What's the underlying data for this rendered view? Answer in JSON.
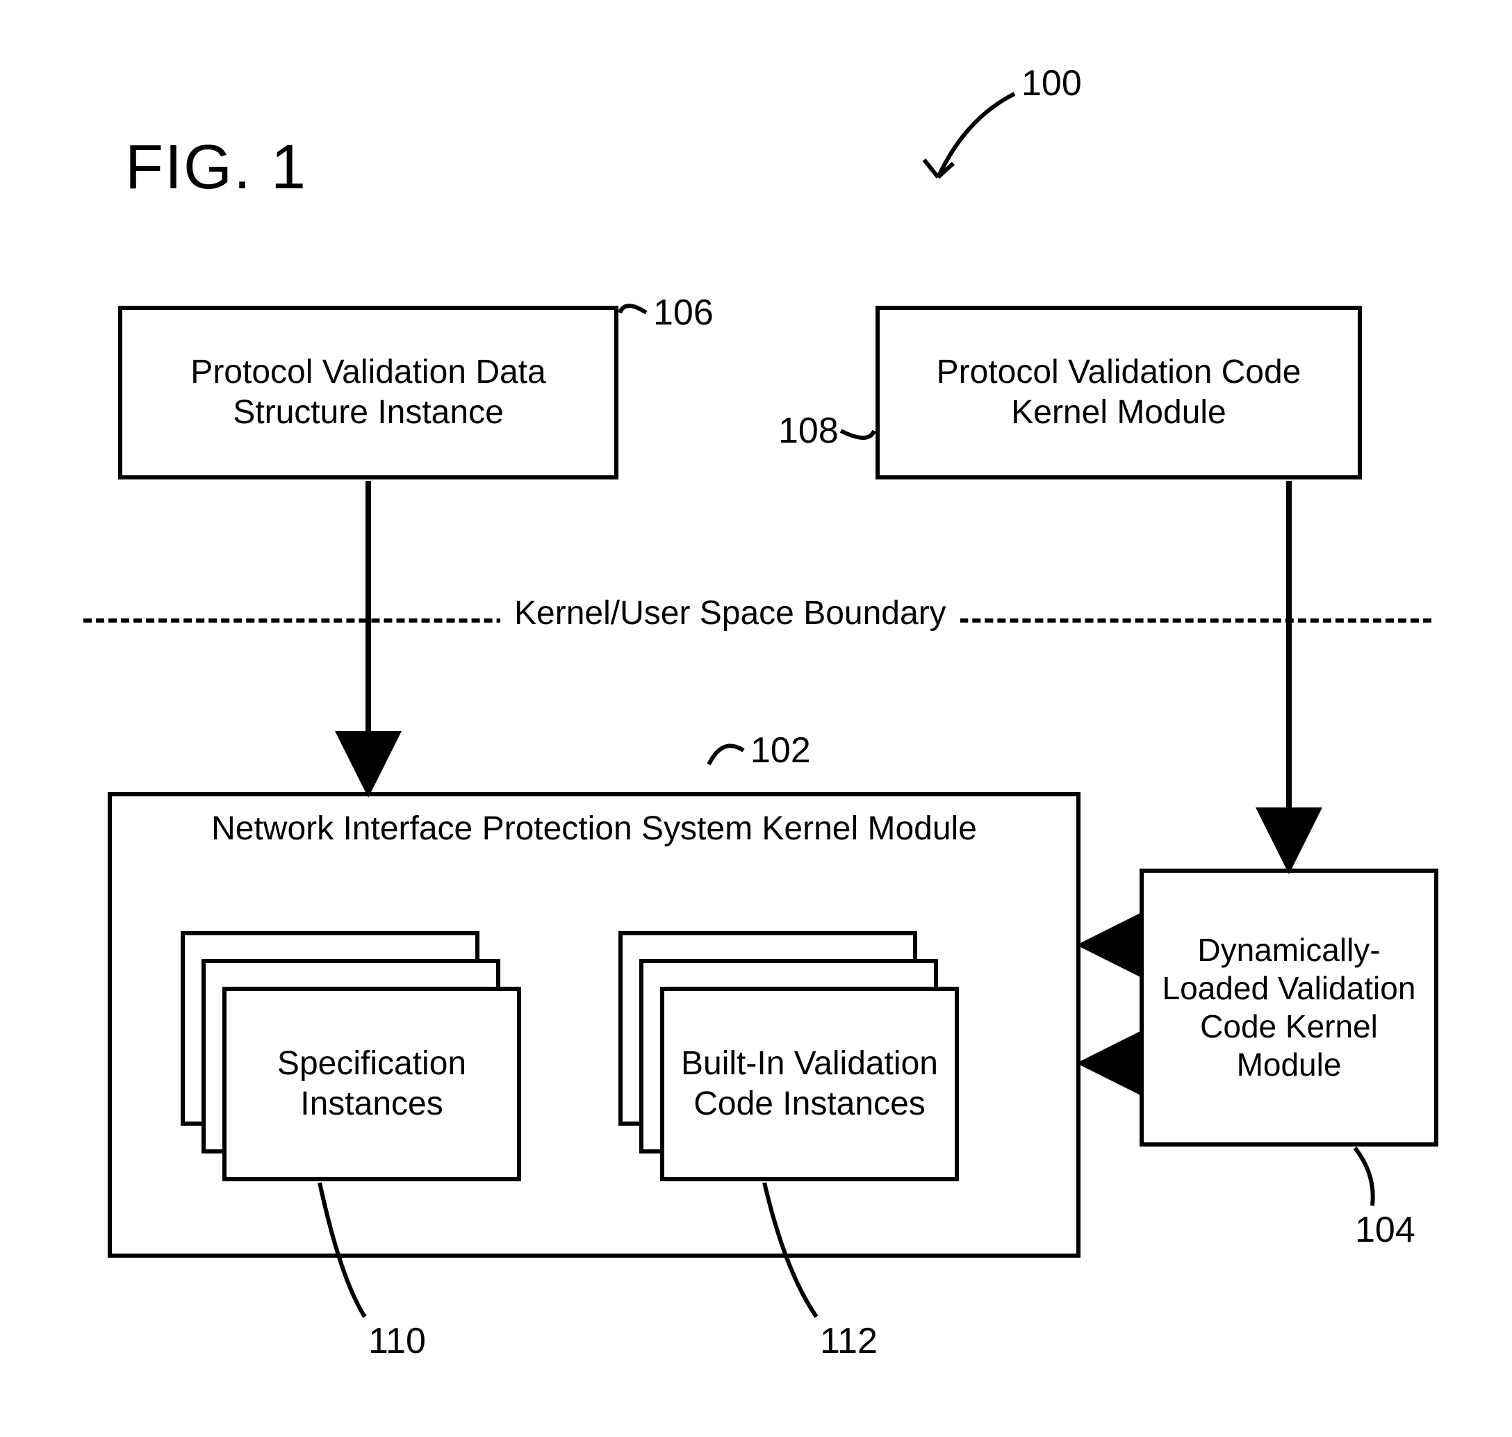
{
  "figure": {
    "title": "FIG. 1",
    "overall_ref": "100",
    "boundary_label": "Kernel/User Space Boundary"
  },
  "boxes": {
    "pvds": {
      "label": "Protocol Validation Data Structure Instance",
      "ref": "106"
    },
    "pvckm": {
      "label": "Protocol Validation Code Kernel Module",
      "ref": "108"
    },
    "nips": {
      "label": "Network Interface Protection System Kernel Module",
      "ref": "102"
    },
    "spec": {
      "label": "Specification Instances",
      "ref": "110"
    },
    "builtin": {
      "label": "Built-In Validation Code Instances",
      "ref": "112"
    },
    "dlvc": {
      "label": "Dynamically-Loaded Validation Code Kernel Module",
      "ref": "104"
    }
  },
  "chart_data": {
    "type": "diagram",
    "nodes": [
      {
        "id": "106",
        "label": "Protocol Validation Data Structure Instance",
        "region": "user-space"
      },
      {
        "id": "108",
        "label": "Protocol Validation Code Kernel Module",
        "region": "user-space"
      },
      {
        "id": "102",
        "label": "Network Interface Protection System Kernel Module",
        "region": "kernel-space"
      },
      {
        "id": "110",
        "label": "Specification Instances",
        "parent": "102",
        "region": "kernel-space",
        "stacked": true
      },
      {
        "id": "112",
        "label": "Built-In Validation Code Instances",
        "parent": "102",
        "region": "kernel-space",
        "stacked": true
      },
      {
        "id": "104",
        "label": "Dynamically-Loaded Validation Code Kernel Module",
        "region": "kernel-space"
      }
    ],
    "edges": [
      {
        "from": "106",
        "to": "102",
        "style": "arrow"
      },
      {
        "from": "108",
        "to": "104",
        "style": "arrow"
      },
      {
        "from": "104",
        "to": "102",
        "style": "arrow",
        "count": 2
      }
    ],
    "boundary": {
      "label": "Kernel/User Space Boundary",
      "style": "dashed-horizontal"
    },
    "overall_ref": "100"
  }
}
